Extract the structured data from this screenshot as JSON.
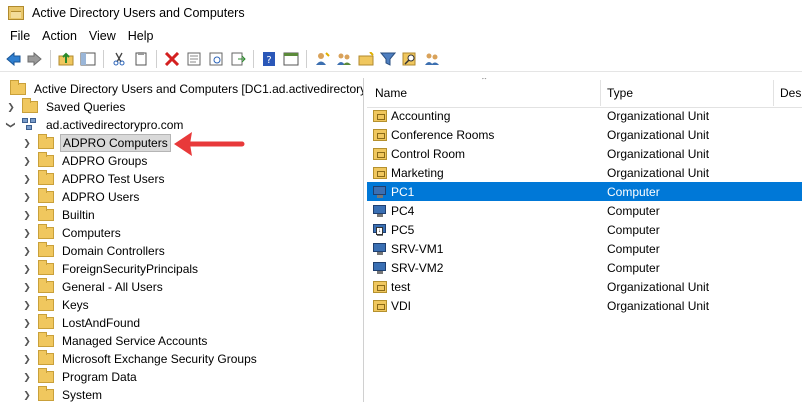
{
  "window": {
    "title": "Active Directory Users and Computers"
  },
  "menu": [
    "File",
    "Action",
    "View",
    "Help"
  ],
  "toolbar": {
    "icons": [
      "back-arrow-icon",
      "forward-arrow-icon",
      "up-folder-icon",
      "show-hide-tree-icon",
      "cut-icon",
      "copy-icon",
      "delete-icon",
      "properties-icon",
      "refresh-icon",
      "export-icon",
      "help-icon",
      "console-icon",
      "new-user-icon",
      "new-group-icon",
      "new-ou-icon",
      "filter-icon",
      "find-icon",
      "add-to-group-icon"
    ]
  },
  "tree": {
    "root": "Active Directory Users and Computers [DC1.ad.activedirectorypr",
    "saved_queries": "Saved Queries",
    "domain": "ad.activedirectorypro.com",
    "items": [
      "ADPRO Computers",
      "ADPRO Groups",
      "ADPRO Test Users",
      "ADPRO Users",
      "Builtin",
      "Computers",
      "Domain Controllers",
      "ForeignSecurityPrincipals",
      "General - All Users",
      "Keys",
      "LostAndFound",
      "Managed Service Accounts",
      "Microsoft Exchange Security Groups",
      "Program Data",
      "System"
    ],
    "selected_index": 0
  },
  "list": {
    "columns": [
      "Name",
      "Type",
      "Des"
    ],
    "rows": [
      {
        "name": "Accounting",
        "type": "Organizational Unit",
        "icon": "ou"
      },
      {
        "name": "Conference Rooms",
        "type": "Organizational Unit",
        "icon": "ou"
      },
      {
        "name": "Control Room",
        "type": "Organizational Unit",
        "icon": "ou"
      },
      {
        "name": "Marketing",
        "type": "Organizational Unit",
        "icon": "ou"
      },
      {
        "name": "PC1",
        "type": "Computer",
        "icon": "pc"
      },
      {
        "name": "PC4",
        "type": "Computer",
        "icon": "pc"
      },
      {
        "name": "PC5",
        "type": "Computer",
        "icon": "pc-disabled"
      },
      {
        "name": "SRV-VM1",
        "type": "Computer",
        "icon": "pc"
      },
      {
        "name": "SRV-VM2",
        "type": "Computer",
        "icon": "pc"
      },
      {
        "name": "test",
        "type": "Organizational Unit",
        "icon": "ou"
      },
      {
        "name": "VDI",
        "type": "Organizational Unit",
        "icon": "ou"
      }
    ],
    "selected_index": 4
  },
  "colors": {
    "selection": "#0078d7",
    "annotation": "#e8393a"
  }
}
